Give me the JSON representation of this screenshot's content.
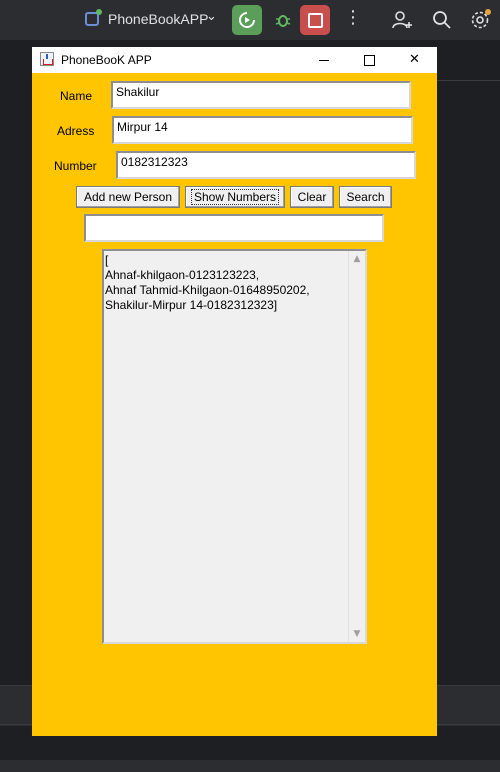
{
  "ide": {
    "project_name": "PhoneBookAPP",
    "icons": [
      "project-icon",
      "chevron-down-icon",
      "run-icon",
      "debug-icon",
      "stop-icon",
      "more-icon",
      "add-user-icon",
      "search-icon",
      "settings-icon"
    ],
    "colors": {
      "run": "#5a9e5a",
      "stop": "#c94f4f",
      "topbar": "#2b2d30"
    }
  },
  "window": {
    "title": "PhoneBooK APP",
    "background": "#ffc600",
    "controls": {
      "close": "✕"
    }
  },
  "form": {
    "name_label": "Name",
    "name_value": "Shakilur",
    "address_label": "Adress",
    "address_value": "Mirpur 14",
    "number_label": "Number",
    "number_value": "0182312323",
    "search_value": ""
  },
  "buttons": {
    "add": "Add new Person",
    "show": "Show Numbers",
    "clear": "Clear",
    "search": "Search"
  },
  "output": {
    "text": "[\nAhnaf-khilgaon-0123123223,\nAhnaf Tahmid-Khilgaon-01648950202,\nShakilur-Mirpur 14-0182312323]"
  }
}
